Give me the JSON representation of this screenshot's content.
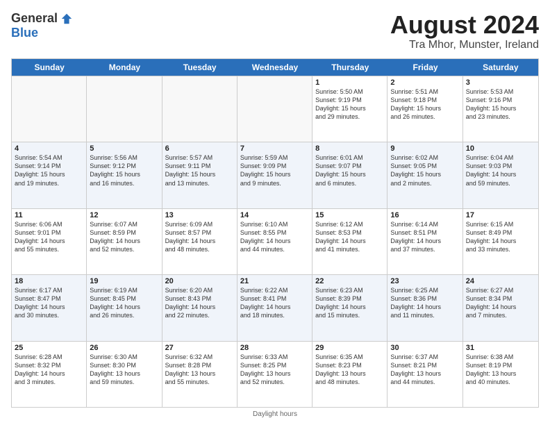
{
  "logo": {
    "general": "General",
    "blue": "Blue"
  },
  "title": "August 2024",
  "location": "Tra Mhor, Munster, Ireland",
  "days_of_week": [
    "Sunday",
    "Monday",
    "Tuesday",
    "Wednesday",
    "Thursday",
    "Friday",
    "Saturday"
  ],
  "footer": "Daylight hours",
  "rows": [
    [
      {
        "day": "",
        "info": "",
        "empty": true
      },
      {
        "day": "",
        "info": "",
        "empty": true
      },
      {
        "day": "",
        "info": "",
        "empty": true
      },
      {
        "day": "",
        "info": "",
        "empty": true
      },
      {
        "day": "1",
        "info": "Sunrise: 5:50 AM\nSunset: 9:19 PM\nDaylight: 15 hours\nand 29 minutes."
      },
      {
        "day": "2",
        "info": "Sunrise: 5:51 AM\nSunset: 9:18 PM\nDaylight: 15 hours\nand 26 minutes."
      },
      {
        "day": "3",
        "info": "Sunrise: 5:53 AM\nSunset: 9:16 PM\nDaylight: 15 hours\nand 23 minutes."
      }
    ],
    [
      {
        "day": "4",
        "info": "Sunrise: 5:54 AM\nSunset: 9:14 PM\nDaylight: 15 hours\nand 19 minutes."
      },
      {
        "day": "5",
        "info": "Sunrise: 5:56 AM\nSunset: 9:12 PM\nDaylight: 15 hours\nand 16 minutes."
      },
      {
        "day": "6",
        "info": "Sunrise: 5:57 AM\nSunset: 9:11 PM\nDaylight: 15 hours\nand 13 minutes."
      },
      {
        "day": "7",
        "info": "Sunrise: 5:59 AM\nSunset: 9:09 PM\nDaylight: 15 hours\nand 9 minutes."
      },
      {
        "day": "8",
        "info": "Sunrise: 6:01 AM\nSunset: 9:07 PM\nDaylight: 15 hours\nand 6 minutes."
      },
      {
        "day": "9",
        "info": "Sunrise: 6:02 AM\nSunset: 9:05 PM\nDaylight: 15 hours\nand 2 minutes."
      },
      {
        "day": "10",
        "info": "Sunrise: 6:04 AM\nSunset: 9:03 PM\nDaylight: 14 hours\nand 59 minutes."
      }
    ],
    [
      {
        "day": "11",
        "info": "Sunrise: 6:06 AM\nSunset: 9:01 PM\nDaylight: 14 hours\nand 55 minutes."
      },
      {
        "day": "12",
        "info": "Sunrise: 6:07 AM\nSunset: 8:59 PM\nDaylight: 14 hours\nand 52 minutes."
      },
      {
        "day": "13",
        "info": "Sunrise: 6:09 AM\nSunset: 8:57 PM\nDaylight: 14 hours\nand 48 minutes."
      },
      {
        "day": "14",
        "info": "Sunrise: 6:10 AM\nSunset: 8:55 PM\nDaylight: 14 hours\nand 44 minutes."
      },
      {
        "day": "15",
        "info": "Sunrise: 6:12 AM\nSunset: 8:53 PM\nDaylight: 14 hours\nand 41 minutes."
      },
      {
        "day": "16",
        "info": "Sunrise: 6:14 AM\nSunset: 8:51 PM\nDaylight: 14 hours\nand 37 minutes."
      },
      {
        "day": "17",
        "info": "Sunrise: 6:15 AM\nSunset: 8:49 PM\nDaylight: 14 hours\nand 33 minutes."
      }
    ],
    [
      {
        "day": "18",
        "info": "Sunrise: 6:17 AM\nSunset: 8:47 PM\nDaylight: 14 hours\nand 30 minutes."
      },
      {
        "day": "19",
        "info": "Sunrise: 6:19 AM\nSunset: 8:45 PM\nDaylight: 14 hours\nand 26 minutes."
      },
      {
        "day": "20",
        "info": "Sunrise: 6:20 AM\nSunset: 8:43 PM\nDaylight: 14 hours\nand 22 minutes."
      },
      {
        "day": "21",
        "info": "Sunrise: 6:22 AM\nSunset: 8:41 PM\nDaylight: 14 hours\nand 18 minutes."
      },
      {
        "day": "22",
        "info": "Sunrise: 6:23 AM\nSunset: 8:39 PM\nDaylight: 14 hours\nand 15 minutes."
      },
      {
        "day": "23",
        "info": "Sunrise: 6:25 AM\nSunset: 8:36 PM\nDaylight: 14 hours\nand 11 minutes."
      },
      {
        "day": "24",
        "info": "Sunrise: 6:27 AM\nSunset: 8:34 PM\nDaylight: 14 hours\nand 7 minutes."
      }
    ],
    [
      {
        "day": "25",
        "info": "Sunrise: 6:28 AM\nSunset: 8:32 PM\nDaylight: 14 hours\nand 3 minutes."
      },
      {
        "day": "26",
        "info": "Sunrise: 6:30 AM\nSunset: 8:30 PM\nDaylight: 13 hours\nand 59 minutes."
      },
      {
        "day": "27",
        "info": "Sunrise: 6:32 AM\nSunset: 8:28 PM\nDaylight: 13 hours\nand 55 minutes."
      },
      {
        "day": "28",
        "info": "Sunrise: 6:33 AM\nSunset: 8:25 PM\nDaylight: 13 hours\nand 52 minutes."
      },
      {
        "day": "29",
        "info": "Sunrise: 6:35 AM\nSunset: 8:23 PM\nDaylight: 13 hours\nand 48 minutes."
      },
      {
        "day": "30",
        "info": "Sunrise: 6:37 AM\nSunset: 8:21 PM\nDaylight: 13 hours\nand 44 minutes."
      },
      {
        "day": "31",
        "info": "Sunrise: 6:38 AM\nSunset: 8:19 PM\nDaylight: 13 hours\nand 40 minutes."
      }
    ]
  ]
}
